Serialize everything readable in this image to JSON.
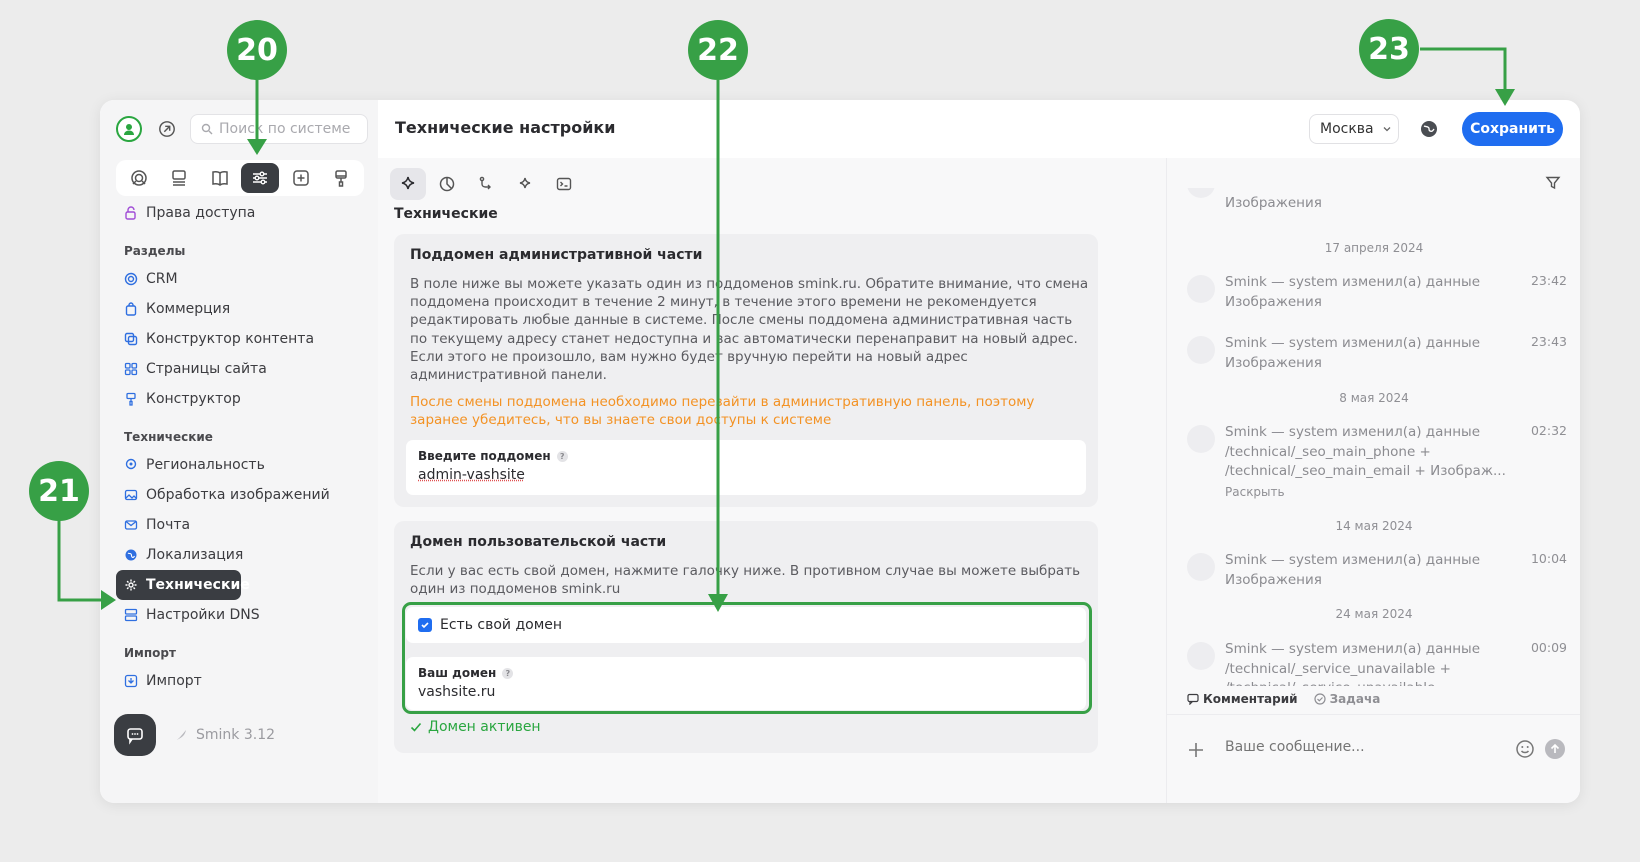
{
  "header": {
    "search_placeholder": "Поиск по системе",
    "page_title": "Технические настройки",
    "city": "Москва",
    "save_label": "Сохранить"
  },
  "sidebar": {
    "access_item": "Права доступа",
    "groups": [
      {
        "title": "Разделы",
        "items": [
          "CRM",
          "Коммерция",
          "Конструктор контента",
          "Страницы сайта",
          "Конструктор"
        ]
      },
      {
        "title": "Технические",
        "items": [
          "Региональность",
          "Обработка изображений",
          "Почта",
          "Локализация",
          "Технические",
          "Настройки DNS"
        ]
      },
      {
        "title": "Импорт",
        "items": [
          "Импорт"
        ]
      }
    ],
    "active_item": "Технические",
    "version": "Smink 3.12"
  },
  "main": {
    "section_title": "Технические",
    "subdomain_card": {
      "title": "Поддомен административной части",
      "description": "В поле ниже вы можете указать один из поддоменов smink.ru. Обратите внимание, что смена поддомена происходит в течение 2 минут, в течение этого времени не рекомендуется редактировать любые данные в системе. После смены поддомена административная часть по текущему адресу станет недоступна и вас автоматически перенаправит на новый адрес. Если этого не произошло, вам нужно будет вручную перейти на новый адрес административной панели.",
      "warning": "После смены поддомена необходимо перезайти в административную панель, поэтому заранее убедитесь, что вы знаете свои доступы к системе",
      "field_label": "Введите поддомен",
      "field_value": "admin-vashsite"
    },
    "domain_card": {
      "title": "Домен пользовательской части",
      "description": "Если у вас есть свой домен, нажмите галочку ниже. В противном случае вы можете выбрать один из поддоменов smink.ru",
      "checkbox_label": "Есть свой домен",
      "checkbox_checked": true,
      "field_label": "Ваш домен",
      "field_value": "vashsite.ru",
      "status": "Домен активен"
    }
  },
  "activity": {
    "top_partial": "Изображения",
    "entries": [
      {
        "date": "17 апреля 2024",
        "text": "Smink — system изменил(а) данные Изображения",
        "time": "23:42"
      },
      {
        "date": "",
        "text": "Smink — system изменил(а) данные Изображения",
        "time": "23:43"
      },
      {
        "date": "8 мая 2024",
        "text": "Smink — system изменил(а) данные /technical/_seo_main_phone + /technical/_seo_main_email + Изображ...",
        "time": "02:32",
        "more": "Раскрыть"
      },
      {
        "date": "14 мая 2024",
        "text": "Smink — system изменил(а) данные Изображения",
        "time": "10:04"
      },
      {
        "date": "24 мая 2024",
        "text": "Smink — system изменил(а) данные /technical/_service_unavailable + /technical/_service_unavailable_...",
        "time": "00:09"
      }
    ],
    "tags": {
      "comment": "Комментарий",
      "task": "Задача"
    },
    "message_placeholder": "Ваше сообщение..."
  },
  "annotations": [
    "20",
    "21",
    "22",
    "23"
  ],
  "colors": {
    "accent": "#1f6df0",
    "annotation": "#37a046",
    "warning": "#f39224",
    "success": "#2aa640"
  }
}
